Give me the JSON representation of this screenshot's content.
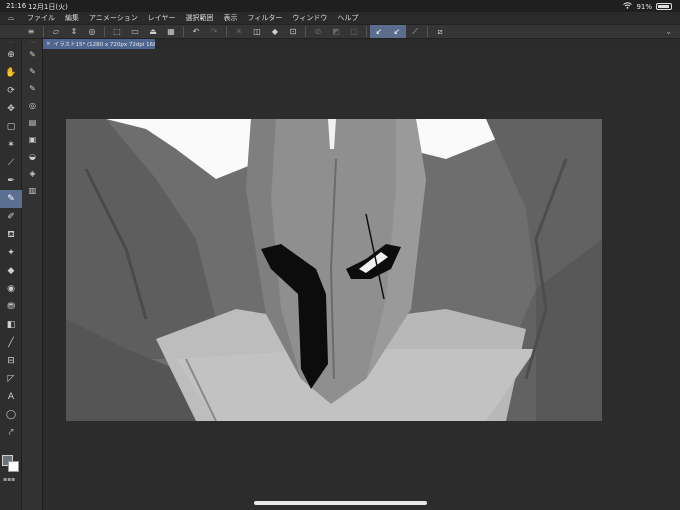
{
  "status": {
    "time": "21:16",
    "date": "12月1日(火)",
    "battery_pct": "91%",
    "battery_level": 0.91,
    "wifi_icon": "wifi-icon",
    "battery_icon": "battery-icon"
  },
  "menu": {
    "items": [
      "ファイル",
      "編集",
      "アニメーション",
      "レイヤー",
      "選択範囲",
      "表示",
      "フィルター",
      "ウィンドウ",
      "ヘルプ"
    ]
  },
  "commands": [
    {
      "icon": "menu-icon"
    },
    {
      "icon": "new-file-icon"
    },
    {
      "icon": "save-icon"
    },
    {
      "icon": "export-icon"
    },
    {
      "icon": "clip-icon"
    },
    {
      "icon": "open-icon"
    },
    {
      "icon": "print-icon"
    },
    {
      "icon": "delete-icon"
    },
    {
      "icon": "undo-icon"
    },
    {
      "icon": "redo-icon"
    },
    {
      "icon": "rotate-icon"
    },
    {
      "icon": "clear-icon"
    },
    {
      "icon": "fill-icon"
    },
    {
      "icon": "transform-icon"
    },
    {
      "icon": "deselect-icon"
    },
    {
      "icon": "invert-icon"
    },
    {
      "icon": "expand-icon"
    },
    {
      "icon": "ruler-snap-icon"
    },
    {
      "icon": "perspective-snap-icon"
    },
    {
      "icon": "special-ruler-icon"
    },
    {
      "icon": "edit-icon"
    }
  ],
  "tab": {
    "label": "イラスト15* (1280 x 720px 72dpi 168.2%)",
    "close_icon": "close-icon"
  },
  "tools": [
    "zoom-icon",
    "hand-icon",
    "rotate-view-icon",
    "move-icon",
    "select-icon",
    "magic-wand-icon",
    "eyedropper-icon",
    "pen-icon",
    "pencil-icon",
    "brush-icon",
    "airbrush-icon",
    "decoration-icon",
    "eraser-icon",
    "blend-icon",
    "fill-icon",
    "gradient-icon",
    "figure-icon",
    "frame-icon",
    "ruler-icon",
    "text-icon",
    "balloon-icon",
    "correct-line-icon"
  ],
  "active_tool_index": 8,
  "subtools": [
    "pen-subtool-1-icon",
    "pen-subtool-2-icon",
    "pen-subtool-3-icon",
    "circle-icon",
    "layer-icon",
    "panel-icon",
    "palette-icon",
    "material-icon",
    "history-icon",
    "navigator-icon"
  ],
  "colors": {
    "foreground": "#6d7278",
    "background": "#ffffff",
    "accent": "#5b6f92"
  }
}
